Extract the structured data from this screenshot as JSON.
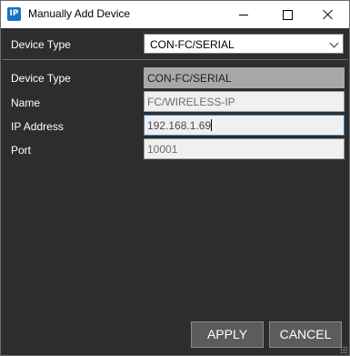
{
  "window": {
    "title": "Manually Add Device",
    "icon_text": "IP"
  },
  "device_type_select": {
    "label": "Device Type",
    "value": "CON-FC/SERIAL",
    "icon": "chevron-down-icon"
  },
  "form": {
    "device_type_label": "Device Type",
    "device_type_value": "CON-FC/SERIAL",
    "name_label": "Name",
    "name_placeholder": "FC/WIRELESS-IP",
    "ip_label": "IP Address",
    "ip_value": "192.168.1.69",
    "port_label": "Port",
    "port_placeholder": "10001"
  },
  "buttons": {
    "apply": "APPLY",
    "cancel": "CANCEL"
  },
  "colors": {
    "background": "#2d2d2d",
    "focus_border": "#3a86d4",
    "button_bg": "#5c5c5c"
  }
}
